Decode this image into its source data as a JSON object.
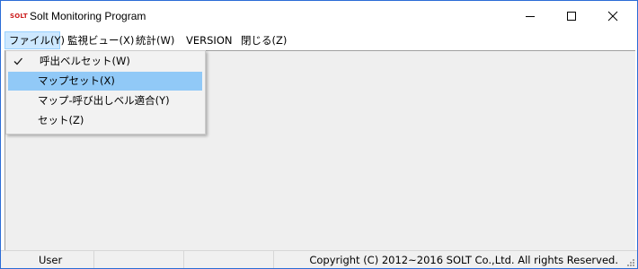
{
  "window": {
    "title": "Solt Monitoring Program",
    "logo_text": "SOLT",
    "accent_color": "#2b6cd6"
  },
  "title_buttons": {
    "minimize_icon": "minimize-icon",
    "maximize_icon": "maximize-icon",
    "close_icon": "close-icon"
  },
  "menubar": {
    "items": [
      {
        "label": "ファイル(Y)",
        "active": true
      },
      {
        "label": "監視ビュー(X)"
      },
      {
        "label": "統計(W)"
      },
      {
        "label": "VERSION"
      },
      {
        "label": "閉じる(Z)"
      }
    ]
  },
  "dropdown": {
    "items": [
      {
        "label": "呼出ベルセット(W)",
        "checked": true
      },
      {
        "label": "マップセット(X)",
        "highlighted": true
      },
      {
        "label": "マップ-呼び出しベル適合(Y)"
      },
      {
        "label": "セット(Z)"
      }
    ],
    "highlight_color": "#91c9f7"
  },
  "statusbar": {
    "user": "User",
    "copyright": "Copyright (C) 2012~2016 SOLT Co.,Ltd. All rights Reserved."
  }
}
